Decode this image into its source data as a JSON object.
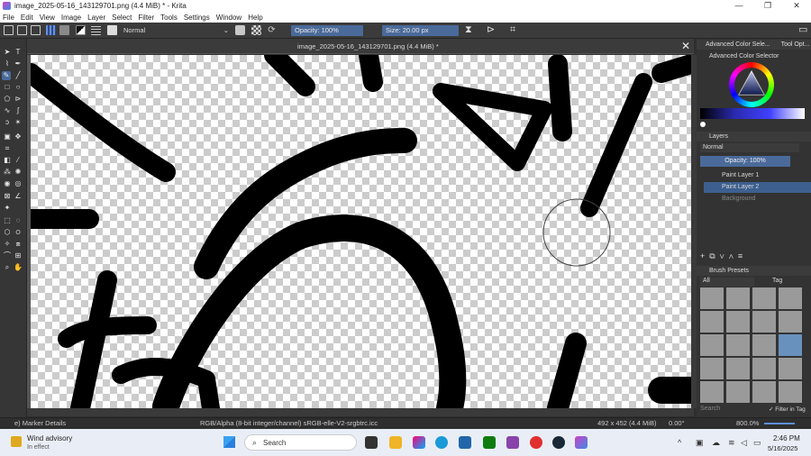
{
  "window": {
    "title": "image_2025-05-16_143129701.png (4.4 MiB) * - Krita",
    "controls": [
      "—",
      "❐",
      "✕"
    ]
  },
  "menu": [
    "File",
    "Edit",
    "View",
    "Image",
    "Layer",
    "Select",
    "Filter",
    "Tools",
    "Settings",
    "Window",
    "Help"
  ],
  "toolbar": {
    "blend_mode": "Normal",
    "opacity": "Opacity: 100%",
    "size": "Size: 20.00 px"
  },
  "document_tab": {
    "label": "image_2025-05-16_143129701.png (4.4 MiB) *"
  },
  "dock": {
    "tabs": [
      "Advanced Color Sele...",
      "Tool Opt..."
    ],
    "color_selector_title": "Advanced Color Selector",
    "layers_title": "Layers",
    "layers_blend": "Normal",
    "layers_opacity": "Opacity:  100%",
    "layers": [
      {
        "name": "Paint Layer 1",
        "selected": false
      },
      {
        "name": "Paint Layer 2",
        "selected": true
      },
      {
        "name": "Background",
        "selected": false
      }
    ],
    "brush_presets_title": "Brush Presets",
    "brush_filter": "All",
    "brush_tag": "Tag",
    "search_placeholder": "Search",
    "filter_in_tag": "Filter in Tag"
  },
  "statusbar": {
    "brush": "e) Marker Details",
    "color_info": "RGB/Alpha (8-bit integer/channel)  sRGB-elle-V2-srgbtrc.icc",
    "dimensions": "492 x 452 (4.4 MiB)",
    "rotation": "0.00°",
    "zoom": "800.0%"
  },
  "taskbar": {
    "weather_title": "Wind advisory",
    "weather_sub": "In effect",
    "search": "Search",
    "time": "2:46 PM",
    "date": "5/16/2025"
  },
  "colors": {
    "accent": "#4a6a9a",
    "selected_layer": "#3d5f8f"
  }
}
